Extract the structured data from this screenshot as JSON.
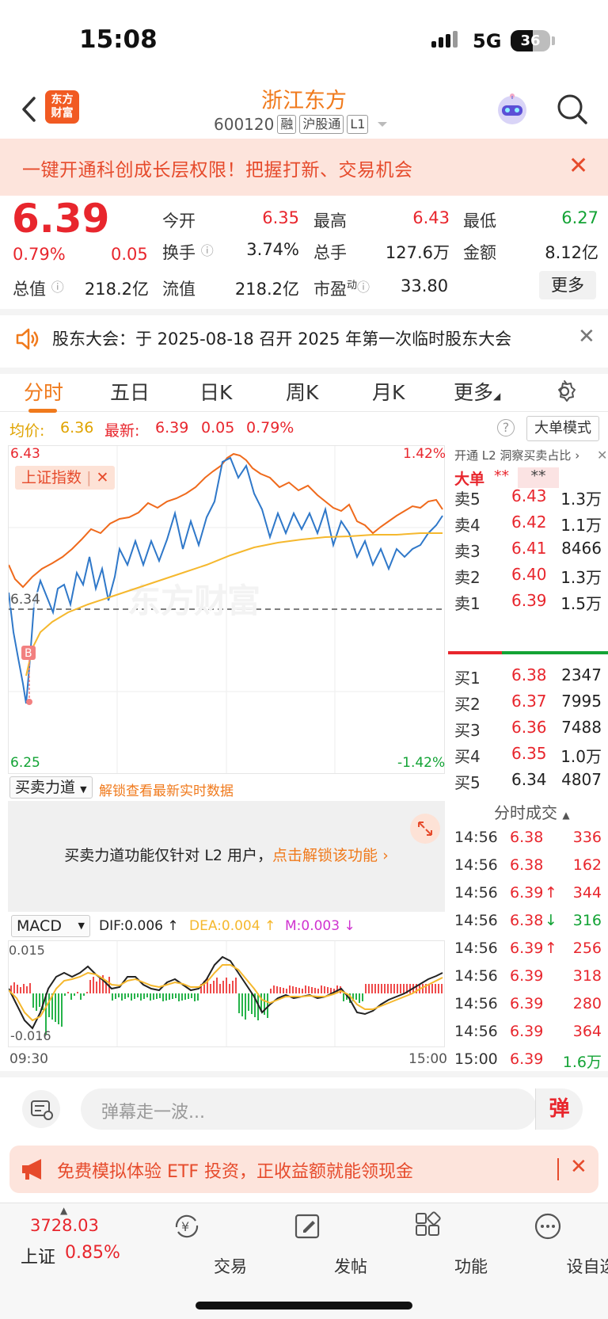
{
  "status": {
    "time": "15:08",
    "network": "5G",
    "battery": "36"
  },
  "header": {
    "logo_text": "东方财富",
    "stock_name": "浙江东方",
    "stock_code": "600120",
    "tags": [
      "融",
      "沪股通",
      "L1"
    ]
  },
  "promo": {
    "text": "一键开通科创成长层权限！把握打新、交易机会"
  },
  "quote": {
    "price": "6.39",
    "change_pct": "0.79%",
    "change": "0.05",
    "open_label": "今开",
    "open": "6.35",
    "high_label": "最高",
    "high": "6.43",
    "low_label": "最低",
    "low": "6.27",
    "turnover_label": "换手",
    "turnover": "3.74%",
    "volume_label": "总手",
    "volume": "127.6万",
    "amount_label": "金额",
    "amount": "8.12亿",
    "mcap_label": "总值",
    "mcap": "218.2亿",
    "float_label": "流值",
    "float": "218.2亿",
    "pe_label": "市盈",
    "pe_sup": "动",
    "pe": "33.80",
    "more_label": "更多"
  },
  "notice": {
    "text": "股东大会：于 2025-08-18 召开 2025 年第一次临时股东大会"
  },
  "tabs": [
    {
      "label": "分时"
    },
    {
      "label": "五日"
    },
    {
      "label": "日K"
    },
    {
      "label": "周K"
    },
    {
      "label": "月K"
    },
    {
      "label": "更多"
    }
  ],
  "avg": {
    "avg_label": "均价:",
    "avg_value": "6.36",
    "latest_label": "最新:",
    "latest_value": "6.39",
    "chg": "0.05",
    "chg_pct": "0.79%",
    "mode_label": "大单模式"
  },
  "chart": {
    "top_price": "6.43",
    "top_pct": "1.42%",
    "mid_price": "6.34",
    "bottom_price": "6.25",
    "bottom_pct": "-1.42%",
    "index_tag": "上证指数",
    "b_marker": "B",
    "watermark": "东方财富"
  },
  "chart_data": {
    "type": "line",
    "x": [
      "09:30",
      "15:00"
    ],
    "ylim": [
      6.25,
      6.43
    ],
    "base": 6.34,
    "series": [
      {
        "name": "上证指数",
        "color": "#ef6a1c"
      },
      {
        "name": "均价",
        "color": "#f5b82e",
        "value_end": 6.36
      }
    ]
  },
  "bs_power": {
    "dropdown": "买卖力道",
    "unlock_text": "解锁查看最新实时数据"
  },
  "l2": {
    "text": "买卖力道功能仅针对 L2 用户，",
    "link": "点击解锁该功能"
  },
  "macd": {
    "dropdown": "MACD",
    "dif": "DIF:0.006",
    "dea": "DEA:0.004",
    "m": "M:0.003",
    "top": "0.015",
    "bottom": "-0.016",
    "t_start": "09:30",
    "t_end": "15:00"
  },
  "orderbook": {
    "banner": "开通 L2 洞察买卖占比",
    "big_label": "大单",
    "big_value1": "**",
    "big_value2": "**",
    "asks": [
      {
        "label": "卖5",
        "price": "6.43",
        "vol": "1.3万"
      },
      {
        "label": "卖4",
        "price": "6.42",
        "vol": "1.1万"
      },
      {
        "label": "卖3",
        "price": "6.41",
        "vol": "8466"
      },
      {
        "label": "卖2",
        "price": "6.40",
        "vol": "1.3万"
      },
      {
        "label": "卖1",
        "price": "6.39",
        "vol": "1.5万"
      }
    ],
    "bids": [
      {
        "label": "买1",
        "price": "6.38",
        "vol": "2347"
      },
      {
        "label": "买2",
        "price": "6.37",
        "vol": "7995"
      },
      {
        "label": "买3",
        "price": "6.36",
        "vol": "7488"
      },
      {
        "label": "买4",
        "price": "6.35",
        "vol": "1.0万"
      },
      {
        "label": "买5",
        "price": "6.34",
        "vol": "4807"
      }
    ],
    "ticks_title": "分时成交",
    "ticks": [
      {
        "time": "14:56",
        "price": "6.38",
        "arrow": "",
        "vol": "336"
      },
      {
        "time": "14:56",
        "price": "6.38",
        "arrow": "",
        "vol": "162"
      },
      {
        "time": "14:56",
        "price": "6.39",
        "arrow": "↑",
        "vol": "344"
      },
      {
        "time": "14:56",
        "price": "6.38",
        "arrow": "↓",
        "vol": "316"
      },
      {
        "time": "14:56",
        "price": "6.39",
        "arrow": "↑",
        "vol": "256"
      },
      {
        "time": "14:56",
        "price": "6.39",
        "arrow": "",
        "vol": "318"
      },
      {
        "time": "14:56",
        "price": "6.39",
        "arrow": "",
        "vol": "280"
      },
      {
        "time": "14:56",
        "price": "6.39",
        "arrow": "",
        "vol": "364"
      },
      {
        "time": "15:00",
        "price": "6.39",
        "arrow": "",
        "vol": "1.6万"
      }
    ]
  },
  "comment": {
    "placeholder": "弹幕走一波...",
    "send": "弹"
  },
  "etf": {
    "text": "免费模拟体验 ETF 投资，正收益额就能领现金"
  },
  "nav": {
    "index_value": "3728.03",
    "index_name": "上证",
    "index_pct": "0.85%",
    "items": [
      {
        "label": "交易"
      },
      {
        "label": "发帖"
      },
      {
        "label": "功能"
      },
      {
        "label": "设自选"
      }
    ]
  }
}
